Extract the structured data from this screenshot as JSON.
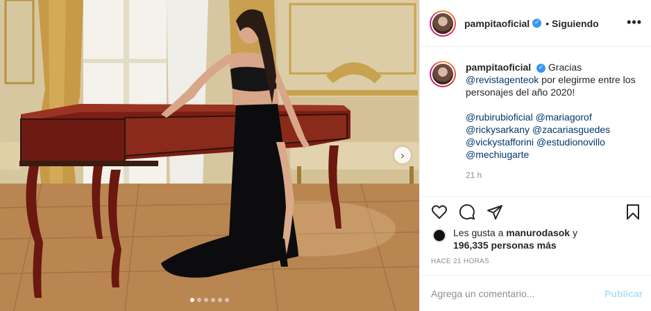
{
  "post": {
    "image_alt": "Mujer con vestido negro posando junto a un clavicordio antiguo en un salón dorado",
    "carousel": {
      "dots": 6,
      "active_index": 0,
      "next_icon": "chevron-right-icon"
    }
  },
  "header": {
    "username": "pampitaoficial",
    "verified_icon": "verified-badge-icon",
    "bullet": "•",
    "follow_status": "Siguiendo",
    "more_icon": "more-options-icon",
    "more_label": "•••"
  },
  "caption": {
    "username": "pampitaoficial",
    "text_lead": "Gracias",
    "mention_main": "@revistagenteok",
    "text_rest": "por elegirme entre los personajes del año 2020!",
    "mentions": [
      "@rubirubioficial",
      "@mariagorof",
      "@rickysarkany",
      "@zacariasguedes",
      "@vickystafforini",
      "@estudionovillo",
      "@mechiugarte"
    ],
    "time": "21 h"
  },
  "actions": {
    "like_icon": "heart-icon",
    "comment_icon": "comment-icon",
    "share_icon": "share-icon",
    "save_icon": "bookmark-icon"
  },
  "likes": {
    "prefix": "Les gusta a",
    "user": "manurodasok",
    "joiner": "y",
    "count": "196,335 personas más"
  },
  "posted_ago": "HACE 21 HORAS",
  "comment": {
    "placeholder": "Agrega un comentario...",
    "publish_label": "Publicar"
  },
  "colors": {
    "link": "#00376b",
    "verified": "#3897f0",
    "publish_disabled": "#b2dffc",
    "muted": "#8e8e8e"
  }
}
